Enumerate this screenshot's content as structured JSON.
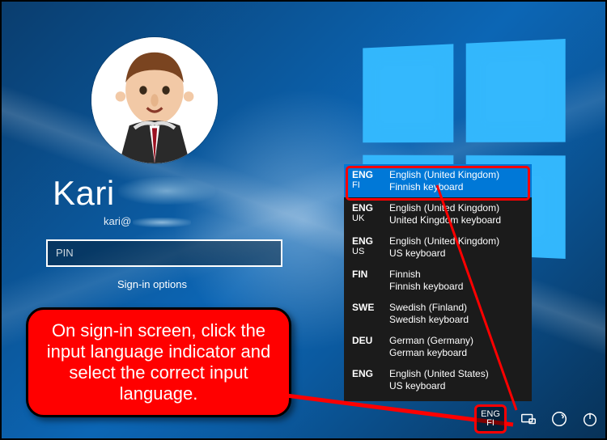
{
  "user": {
    "display_name": "Kari",
    "email_prefix": "kari@"
  },
  "pin": {
    "placeholder": "PIN"
  },
  "signin_options_label": "Sign-in options",
  "callout_text": "On sign-in screen, click the input language indicator and select the correct input language.",
  "language_indicator": {
    "code": "ENG",
    "sub": "FI"
  },
  "language_menu": {
    "selected_index": 0,
    "items": [
      {
        "code": "ENG",
        "sub": "FI",
        "language": "English (United Kingdom)",
        "keyboard": "Finnish keyboard"
      },
      {
        "code": "ENG",
        "sub": "UK",
        "language": "English (United Kingdom)",
        "keyboard": "United Kingdom keyboard"
      },
      {
        "code": "ENG",
        "sub": "US",
        "language": "English (United Kingdom)",
        "keyboard": "US keyboard"
      },
      {
        "code": "FIN",
        "sub": "",
        "language": "Finnish",
        "keyboard": "Finnish keyboard"
      },
      {
        "code": "SWE",
        "sub": "",
        "language": "Swedish (Finland)",
        "keyboard": "Swedish keyboard"
      },
      {
        "code": "DEU",
        "sub": "",
        "language": "German (Germany)",
        "keyboard": "German keyboard"
      },
      {
        "code": "ENG",
        "sub": "",
        "language": "English (United States)",
        "keyboard": "US keyboard"
      }
    ]
  }
}
